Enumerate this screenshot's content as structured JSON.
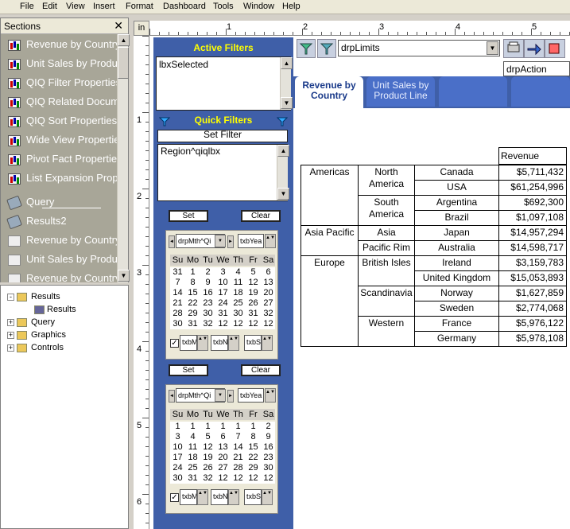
{
  "menu": [
    "File",
    "Edit",
    "View",
    "Insert",
    "Format",
    "Dashboard",
    "Tools",
    "Window",
    "Help"
  ],
  "sections": {
    "title": "Sections",
    "close": "✕",
    "items": [
      {
        "label": "Revenue by Country",
        "icon": "chart-icon"
      },
      {
        "label": "Unit Sales by Product Line",
        "icon": "chart-icon"
      },
      {
        "label": "QIQ Filter Properties",
        "icon": "chart-icon"
      },
      {
        "label": "QIQ Related Documents",
        "icon": "chart-icon"
      },
      {
        "label": "QIQ Sort Properties",
        "icon": "chart-icon"
      },
      {
        "label": "Wide View Properties",
        "icon": "chart-icon"
      },
      {
        "label": "Pivot Fact Properties",
        "icon": "chart-icon"
      },
      {
        "label": "List Expansion Properties",
        "icon": "chart-icon"
      },
      {
        "label": "Query",
        "icon": "query-icon"
      },
      {
        "label": "Results2",
        "icon": "query-icon"
      },
      {
        "label": "Revenue by Country",
        "icon": "table-icon"
      },
      {
        "label": "Unit Sales by Product Line",
        "icon": "table-icon"
      },
      {
        "label": "Revenue by Country",
        "icon": "table-icon"
      }
    ]
  },
  "tree": [
    {
      "label": "Results",
      "level": 0,
      "toggle": "-"
    },
    {
      "label": "Results",
      "level": 1,
      "toggle": ""
    },
    {
      "label": "Query",
      "level": 0,
      "toggle": "+"
    },
    {
      "label": "Graphics",
      "level": 0,
      "toggle": "+"
    },
    {
      "label": "Controls",
      "level": 0,
      "toggle": "+"
    }
  ],
  "ruler": {
    "corner": "in",
    "h": [
      "1",
      "2",
      "3",
      "4",
      "5"
    ],
    "v": [
      "1",
      "2",
      "3",
      "4",
      "5",
      "6"
    ]
  },
  "filters": {
    "active_title": "Active Filters",
    "active_list": "lbxSelected",
    "quick_title": "Quick Filters",
    "set_filter": "Set Filter",
    "quick_list": "Region^qiqlbx",
    "set": "Set",
    "clear": "Clear"
  },
  "calendars": [
    {
      "month_dd": "drpMth^Qi",
      "year_box": "txbYea",
      "days": [
        "Su",
        "Mo",
        "Tu",
        "We",
        "Th",
        "Fr",
        "Sa"
      ],
      "weeks": [
        [
          "31",
          "1",
          "2",
          "3",
          "4",
          "5",
          "6"
        ],
        [
          "7",
          "8",
          "9",
          "10",
          "11",
          "12",
          "13"
        ],
        [
          "14",
          "15",
          "16",
          "17",
          "18",
          "19",
          "20"
        ],
        [
          "21",
          "22",
          "23",
          "24",
          "25",
          "26",
          "27"
        ],
        [
          "28",
          "29",
          "30",
          "31",
          "30",
          "31",
          "32"
        ],
        [
          "30",
          "31",
          "32",
          "12",
          "12",
          "12",
          "12"
        ]
      ],
      "footer": [
        "txbM",
        "txbN",
        "txbS"
      ]
    },
    {
      "month_dd": "drpMth^Qi",
      "year_box": "txbYea",
      "days": [
        "Su",
        "Mo",
        "Tu",
        "We",
        "Th",
        "Fr",
        "Sa"
      ],
      "weeks": [
        [
          "1",
          "1",
          "1",
          "1",
          "1",
          "1",
          "2"
        ],
        [
          "3",
          "4",
          "5",
          "6",
          "7",
          "8",
          "9"
        ],
        [
          "10",
          "11",
          "12",
          "13",
          "14",
          "15",
          "16"
        ],
        [
          "17",
          "18",
          "19",
          "20",
          "21",
          "22",
          "23"
        ],
        [
          "24",
          "25",
          "26",
          "27",
          "28",
          "29",
          "30"
        ],
        [
          "30",
          "31",
          "32",
          "12",
          "12",
          "12",
          "12"
        ]
      ],
      "footer": [
        "txbM",
        "txbN",
        "txbS"
      ]
    }
  ],
  "controls": {
    "drp_limits": "drpLimits",
    "drp_action": "drpAction"
  },
  "tabs": [
    {
      "label": "Revenue by Country",
      "active": true
    },
    {
      "label": "Unit Sales by Product Line",
      "active": false
    },
    {
      "label": "",
      "active": false
    },
    {
      "label": "",
      "active": false
    }
  ],
  "pivot": {
    "header": "Revenue",
    "rows": [
      {
        "region": "Americas",
        "sub": "North America",
        "country": "Canada",
        "value": "$5,711,432"
      },
      {
        "region": "",
        "sub": "",
        "country": "USA",
        "value": "$61,254,996"
      },
      {
        "region": "",
        "sub": "South America",
        "country": "Argentina",
        "value": "$692,300"
      },
      {
        "region": "",
        "sub": "",
        "country": "Brazil",
        "value": "$1,097,108"
      },
      {
        "region": "Asia Pacific",
        "sub": "Asia",
        "country": "Japan",
        "value": "$14,957,294"
      },
      {
        "region": "",
        "sub": "Pacific Rim",
        "country": "Australia",
        "value": "$14,598,717"
      },
      {
        "region": "Europe",
        "sub": "British Isles",
        "country": "Ireland",
        "value": "$3,159,783"
      },
      {
        "region": "",
        "sub": "",
        "country": "United Kingdom",
        "value": "$15,053,893"
      },
      {
        "region": "",
        "sub": "Scandinavia",
        "country": "Norway",
        "value": "$1,627,859"
      },
      {
        "region": "",
        "sub": "",
        "country": "Sweden",
        "value": "$2,774,068"
      },
      {
        "region": "",
        "sub": "Western",
        "country": "France",
        "value": "$5,976,122"
      },
      {
        "region": "",
        "sub": "",
        "country": "Germany",
        "value": "$5,978,108"
      }
    ]
  }
}
